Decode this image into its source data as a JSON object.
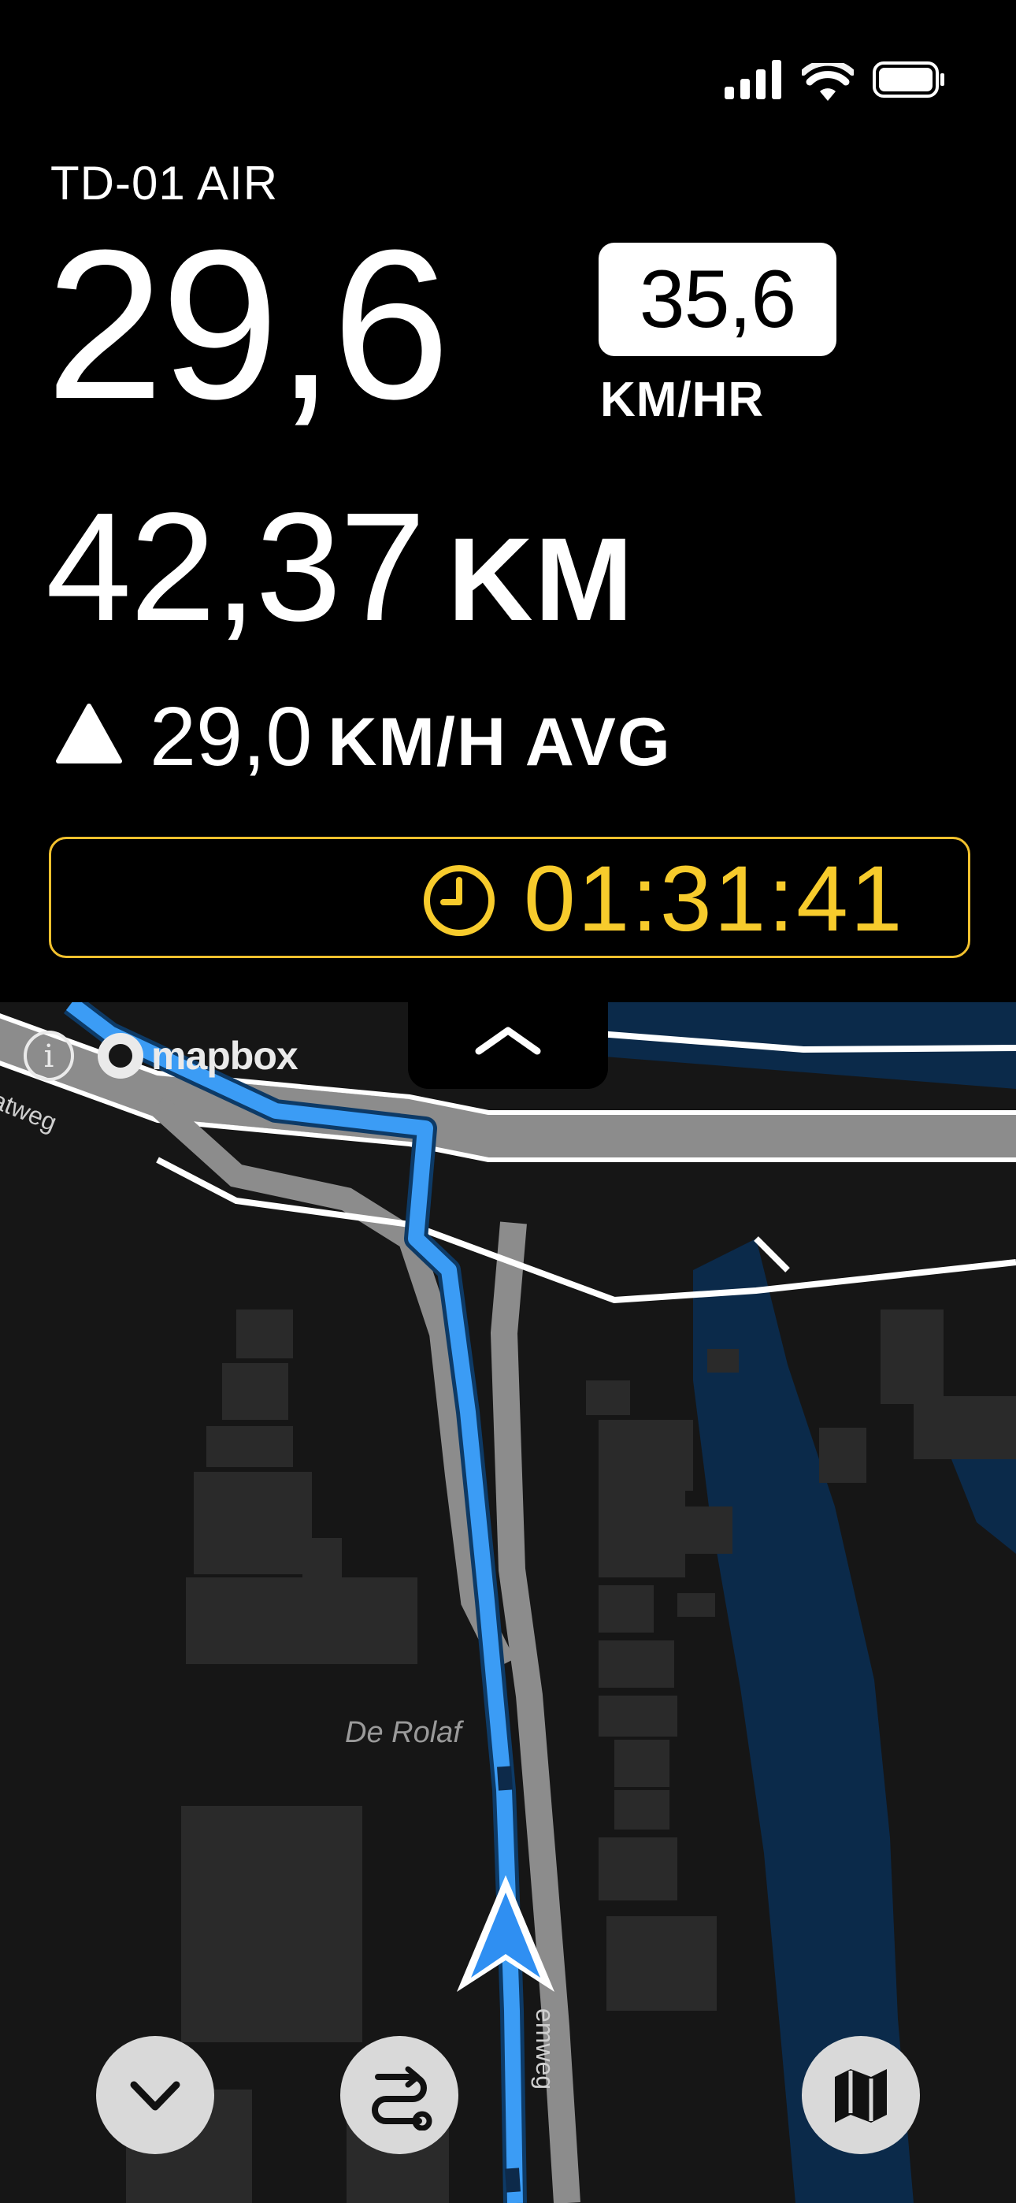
{
  "device": {
    "name": "TD-01 AIR"
  },
  "speed": {
    "current": "29,6",
    "max": "35,6",
    "unit": "KM/HR"
  },
  "distance": {
    "value": "42,37",
    "unit": "KM"
  },
  "average": {
    "value": "29,0",
    "unit": "KM/H AVG"
  },
  "timer": {
    "elapsed": "01:31:41"
  },
  "map": {
    "place_label": "De Rolaf",
    "road_label_left": "atweg",
    "road_label_bottom": "emweg",
    "attribution": "mapbox",
    "info_glyph": "i"
  },
  "colors": {
    "accent_yellow": "#f7cb2c",
    "route_blue": "#3b9cf5",
    "water_blue": "#0b2a4a",
    "map_background": "#161616"
  },
  "icons": {
    "collapse": "chevron-up-icon",
    "down": "chevron-down-icon",
    "route": "route-icon",
    "map_view": "map-icon",
    "clock": "clock-icon",
    "average": "triangle-icon"
  }
}
